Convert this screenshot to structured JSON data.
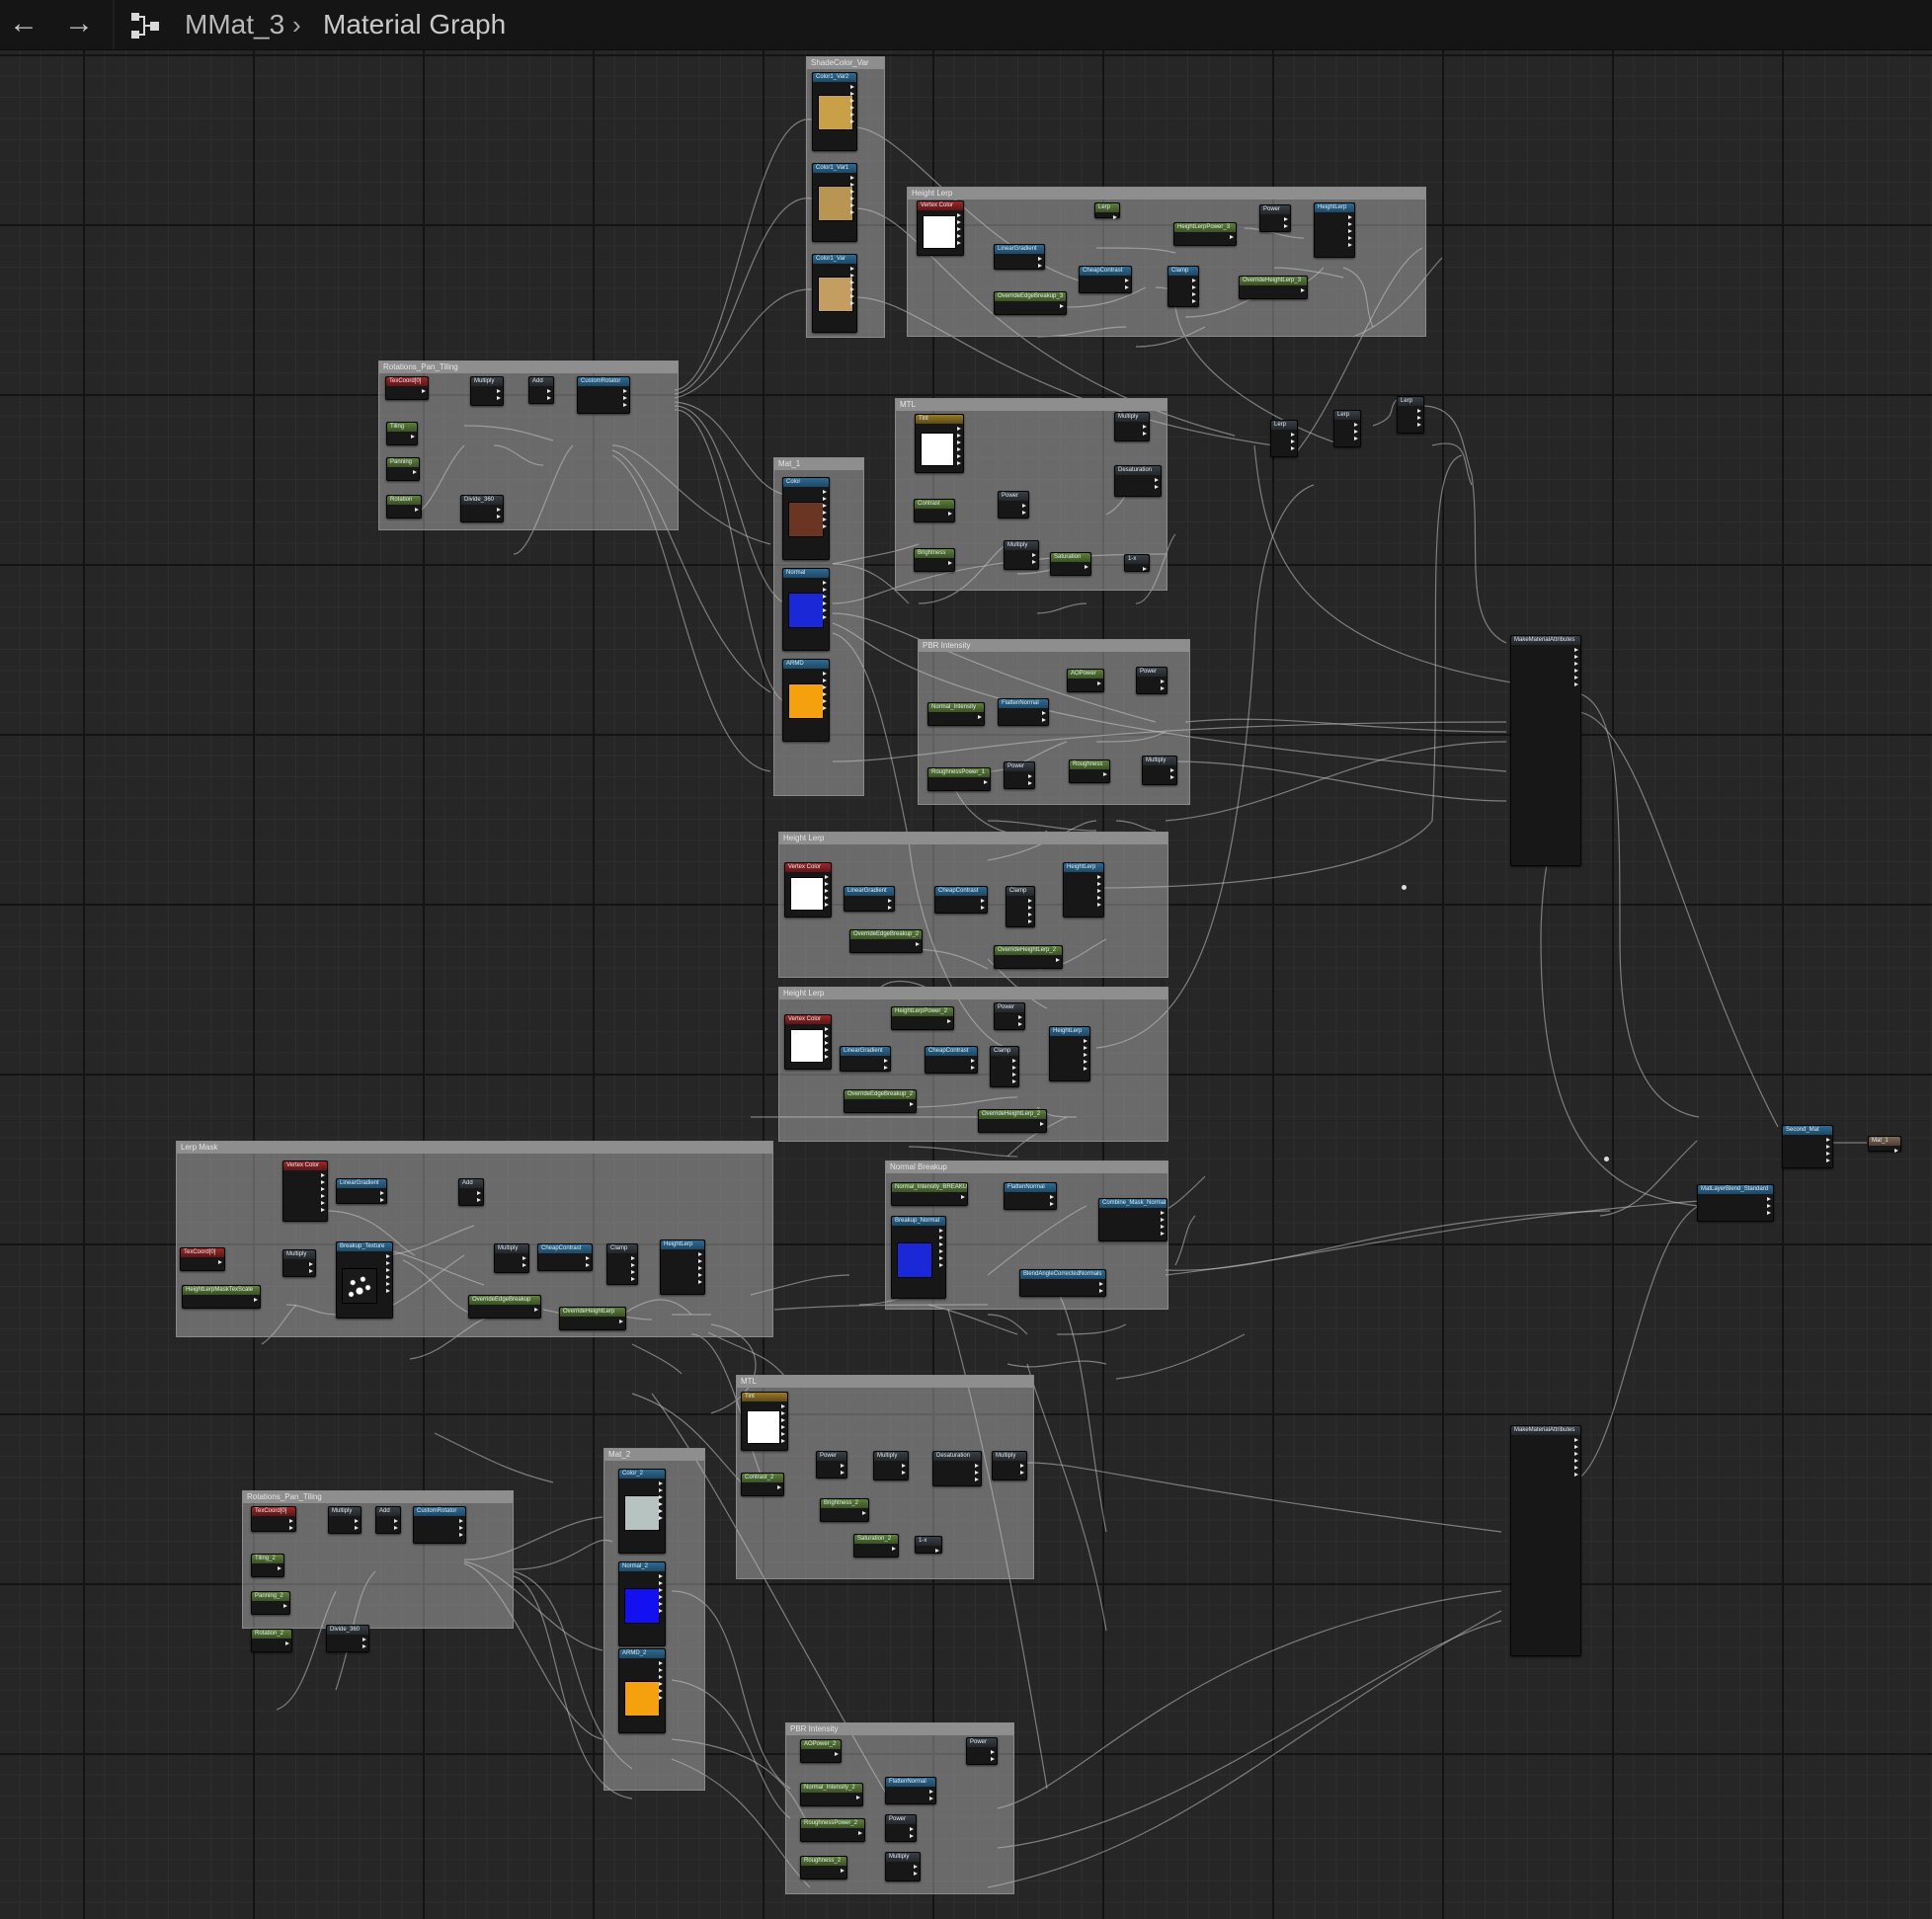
{
  "toolbar": {
    "back_icon": "arrow-left-icon",
    "forward_icon": "arrow-right-icon",
    "graph_icon": "material-graph-icon",
    "breadcrumb_root": "MMat_3",
    "breadcrumb_separator": "chevron-right-icon",
    "breadcrumb_current": "Material Graph"
  },
  "comments": [
    {
      "id": "c_shade",
      "title": "ShadeColor_Var"
    },
    {
      "id": "c_height_top",
      "title": "Height Lerp"
    },
    {
      "id": "c_rot1",
      "title": "Rotations_Pan_Tiling"
    },
    {
      "id": "c_mat1",
      "title": "Mat_1"
    },
    {
      "id": "c_mtl",
      "title": "MTL"
    },
    {
      "id": "c_pbr1",
      "title": "PBR Intensity"
    },
    {
      "id": "c_height2",
      "title": "Height Lerp"
    },
    {
      "id": "c_height3",
      "title": "Height Lerp"
    },
    {
      "id": "c_lerpmask",
      "title": "Lerp Mask"
    },
    {
      "id": "c_normal",
      "title": "Normal Breakup"
    },
    {
      "id": "c_mtl2",
      "title": "MTL"
    },
    {
      "id": "c_rot2",
      "title": "Rotations_Pan_Tiling"
    },
    {
      "id": "c_mat2",
      "title": "Mat_2"
    },
    {
      "id": "c_pbr2",
      "title": "PBR Intensity"
    }
  ],
  "nodes": [
    {
      "label": "Color1_Var2"
    },
    {
      "label": "Color1_Var1"
    },
    {
      "label": "Color1_Var"
    },
    {
      "label": "Vertex Color"
    },
    {
      "label": "LinearGradient"
    },
    {
      "label": "Lerp"
    },
    {
      "label": "CheapContrast"
    },
    {
      "label": "Clamp"
    },
    {
      "label": "Power"
    },
    {
      "label": "HeightLerpPower_3"
    },
    {
      "label": "HeightLerp"
    },
    {
      "label": "OverrideEdgeBreakup_3"
    },
    {
      "label": "OverrideHeightLerp_3"
    },
    {
      "label": "TexCoord[0]"
    },
    {
      "label": "Multiply"
    },
    {
      "label": "Add"
    },
    {
      "label": "CustomRotator"
    },
    {
      "label": "Tiling"
    },
    {
      "label": "Panning"
    },
    {
      "label": "Rotation"
    },
    {
      "label": "Divide_360"
    },
    {
      "label": "Color"
    },
    {
      "label": "Normal"
    },
    {
      "label": "ARMD"
    },
    {
      "label": "Tint"
    },
    {
      "label": "Multiply"
    },
    {
      "label": "Desaturation"
    },
    {
      "label": "Saturation"
    },
    {
      "label": "Power"
    },
    {
      "label": "Multiply"
    },
    {
      "label": "Contrast"
    },
    {
      "label": "Brightness"
    },
    {
      "label": "1-x"
    },
    {
      "label": "AOPower"
    },
    {
      "label": "Power"
    },
    {
      "label": "Normal_Intensity"
    },
    {
      "label": "FlattenNormal"
    },
    {
      "label": "RoughnessPower_1"
    },
    {
      "label": "Power"
    },
    {
      "label": "Roughness"
    },
    {
      "label": "Multiply"
    },
    {
      "label": "Lerp"
    },
    {
      "label": "Lerp"
    },
    {
      "label": "Lerp"
    },
    {
      "label": "MakeMaterialAttributes"
    },
    {
      "label": "Second_Mat"
    },
    {
      "label": "Mat_1"
    },
    {
      "label": "MatLayerBlend_Standard"
    },
    {
      "label": "Vertex Color"
    },
    {
      "label": "LinearGradient"
    },
    {
      "label": "CheapContrast"
    },
    {
      "label": "Clamp"
    },
    {
      "label": "HeightLerp"
    },
    {
      "label": "OverrideEdgeBreakup_2"
    },
    {
      "label": "OverrideHeightLerp_2"
    },
    {
      "label": "HeightLerpPower_2"
    },
    {
      "label": "Power"
    },
    {
      "label": "TexCoord[0]"
    },
    {
      "label": "Multiply"
    },
    {
      "label": "Breakup_Texture"
    },
    {
      "label": "HeightLerpMaskTexScale"
    },
    {
      "label": "OverrideEdgeBreakup"
    },
    {
      "label": "OverrideHeightLerp"
    },
    {
      "label": "Normal_Intensity_BREAKUP"
    },
    {
      "label": "FlattenNormal"
    },
    {
      "label": "Breakup_Normal"
    },
    {
      "label": "Combine_Mask_Normal"
    },
    {
      "label": "BlendAngleCorrectedNormals"
    },
    {
      "label": "Color_2"
    },
    {
      "label": "Normal_2"
    },
    {
      "label": "ARMD_2"
    },
    {
      "label": "Contrast_2"
    },
    {
      "label": "Brightness_2"
    },
    {
      "label": "Saturation_2"
    },
    {
      "label": "Tiling_2"
    },
    {
      "label": "Panning_2"
    },
    {
      "label": "Rotation_2"
    },
    {
      "label": "AOPower_2"
    },
    {
      "label": "Normal_Intensity_2"
    },
    {
      "label": "RoughnessPower_2"
    },
    {
      "label": "Roughness_2"
    }
  ],
  "colors": {
    "canvas": "#262626",
    "grid_major": "#131313",
    "grid_minor": "#2e2e2e",
    "comment_fill": "#c8c8c8",
    "node_body": "#171717",
    "param_header": "#5f7f3c",
    "texture_header": "#2f6a92",
    "vertex_header": "#9b2828",
    "function_header": "#3a3f45",
    "wire": "#c8c8c8"
  }
}
